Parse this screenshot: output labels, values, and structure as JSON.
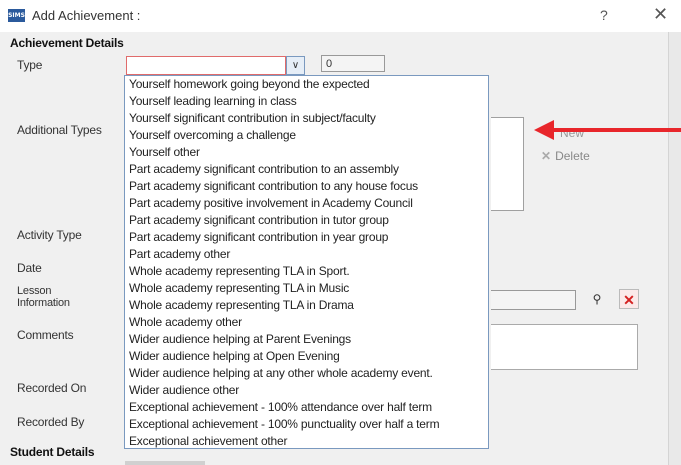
{
  "window": {
    "app_icon_text": "SIMS",
    "title": "Add Achievement : ",
    "help": "?",
    "close": "✕"
  },
  "sections": {
    "achievement_details": "Achievement Details",
    "student_details": "Student Details"
  },
  "labels": {
    "type": "Type",
    "additional_types": "Additional Types",
    "activity_type": "Activity Type",
    "date": "Date",
    "lesson_information": "Lesson\nInformation",
    "comments": "Comments",
    "recorded_on": "Recorded On",
    "recorded_by": "Recorded By"
  },
  "type_field": {
    "value": "",
    "points_value": "0"
  },
  "additional_types": {
    "new_label": "New",
    "delete_label": "Delete"
  },
  "type_options": [
    "Yourself homework going beyond the expected",
    "Yourself leading learning in class",
    "Yourself significant contribution in subject/faculty",
    "Yourself overcoming a challenge",
    "Yourself other",
    "Part academy significant contribution to an assembly",
    "Part academy significant contribution to any house focus",
    "Part academy positive involvement in Academy Council",
    "Part academy significant contribution in tutor group",
    "Part academy significant contribution in year group",
    "Part academy other",
    "Whole academy representing TLA in Sport.",
    "Whole academy representing TLA in Music",
    "Whole academy representing TLA in Drama",
    "Whole academy other",
    "Wider audience helping at Parent Evenings",
    "Wider audience helping at Open Evening",
    "Wider audience helping at any other whole academy event.",
    "Wider audience other",
    "Exceptional achievement - 100% attendance over half term",
    "Exceptional achievement - 100% punctuality over half a term",
    "Exceptional achievement other"
  ],
  "colors": {
    "annotation_arrow": "#e8262b",
    "dropdown_border": "#7a99bf",
    "invalid_field_border": "#e06b6b"
  }
}
